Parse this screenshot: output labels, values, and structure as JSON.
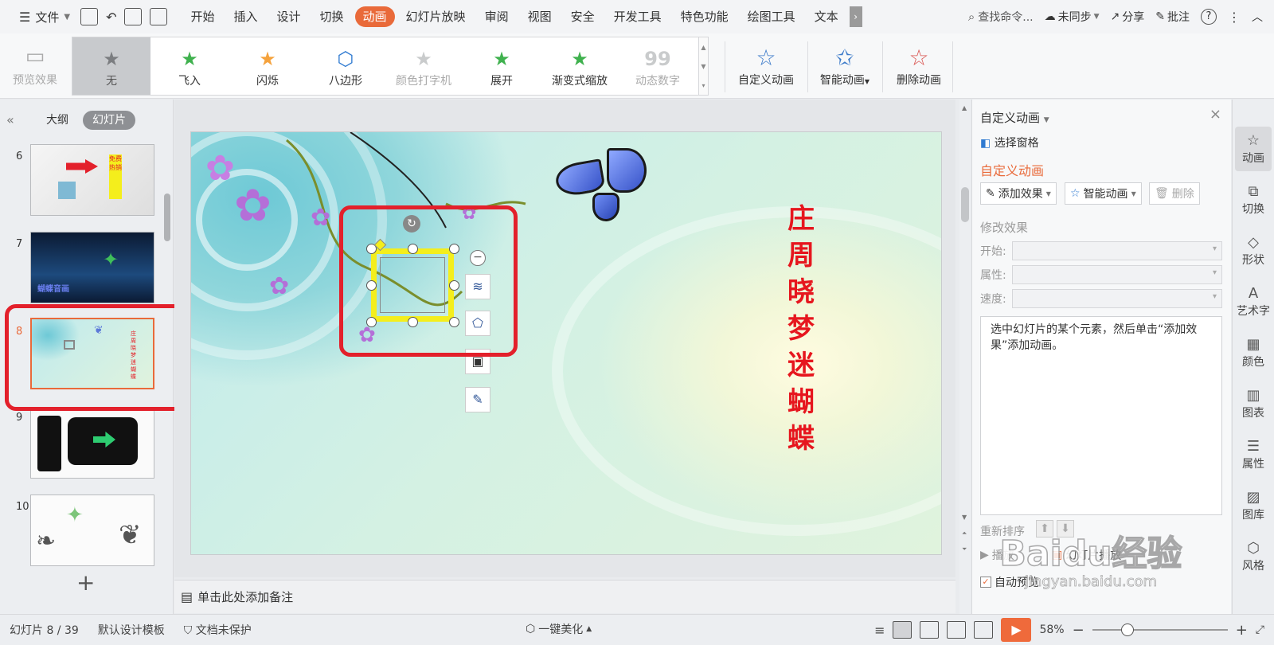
{
  "menubar": {
    "file_menu": "文件",
    "tabs": [
      {
        "label": "开始"
      },
      {
        "label": "插入"
      },
      {
        "label": "设计"
      },
      {
        "label": "切换"
      },
      {
        "label": "动画"
      },
      {
        "label": "幻灯片放映"
      },
      {
        "label": "审阅"
      },
      {
        "label": "视图"
      },
      {
        "label": "安全"
      },
      {
        "label": "开发工具"
      },
      {
        "label": "特色功能"
      },
      {
        "label": "绘图工具"
      },
      {
        "label": "文本"
      }
    ],
    "active_tab": "动画",
    "search": "查找命令...",
    "sync": "未同步",
    "share": "分享",
    "comment": "批注"
  },
  "ribbon": {
    "preview": "预览效果",
    "effects": [
      {
        "label": "无",
        "state": "selected"
      },
      {
        "label": "飞入",
        "state": "normal"
      },
      {
        "label": "闪烁",
        "state": "normal"
      },
      {
        "label": "八边形",
        "state": "normal"
      },
      {
        "label": "颜色打字机",
        "state": "disabled"
      },
      {
        "label": "展开",
        "state": "normal"
      },
      {
        "label": "渐变式缩放",
        "state": "normal"
      },
      {
        "label": "动态数字",
        "state": "disabled"
      }
    ],
    "custom_animation": "自定义动画",
    "smart_animation": "智能动画",
    "delete_animation": "删除动画"
  },
  "slides_panel": {
    "tab_outline": "大纲",
    "tab_slides": "幻灯片",
    "slides": [
      {
        "num": "6",
        "caption": "免费热销"
      },
      {
        "num": "7",
        "caption": "蝴蝶音画"
      },
      {
        "num": "8",
        "caption": "庄周晓梦迷蝴蝶"
      },
      {
        "num": "9",
        "caption": ""
      },
      {
        "num": "10",
        "caption": ""
      }
    ],
    "current_slide": "8"
  },
  "slide": {
    "vertical_title": [
      "庄",
      "周",
      "晓",
      "梦",
      "迷",
      "蝴",
      "蝶"
    ]
  },
  "notes": {
    "placeholder": "单击此处添加备注"
  },
  "right_panel": {
    "title": "自定义动画",
    "select_pane": "选择窗格",
    "section_title": "自定义动画",
    "add_effect": "添加效果",
    "smart_animation": "智能动画",
    "delete": "删除",
    "modify_effect": "修改效果",
    "start_label": "开始:",
    "property_label": "属性:",
    "speed_label": "速度:",
    "hint": "选中幻灯片的某个元素，然后单击“添加效果”添加动画。",
    "reorder": "重新排序",
    "play": "播放",
    "slideshow": "幻灯片播放",
    "auto_preview": "自动预览"
  },
  "side_rail": [
    {
      "label": "动画",
      "icon": "star-icon"
    },
    {
      "label": "切换",
      "icon": "transition-icon"
    },
    {
      "label": "形状",
      "icon": "shape-icon"
    },
    {
      "label": "艺术字",
      "icon": "wordart-icon"
    },
    {
      "label": "颜色",
      "icon": "color-icon"
    },
    {
      "label": "图表",
      "icon": "chart-icon"
    },
    {
      "label": "属性",
      "icon": "properties-icon"
    },
    {
      "label": "图库",
      "icon": "gallery-icon"
    },
    {
      "label": "风格",
      "icon": "style-icon"
    }
  ],
  "statusbar": {
    "slide_counter": "幻灯片 8 / 39",
    "template": "默认设计模板",
    "protection": "文档未保护",
    "beautify": "一键美化",
    "zoom": "58%"
  },
  "watermark": {
    "line1": "Baidu经验",
    "line2": "jingyan.baidu.com"
  },
  "colors": {
    "accent": "#e96a3a",
    "highlight_red": "#e3202b",
    "selection_yellow": "#f4ee1c",
    "title_red": "#e6161e"
  }
}
